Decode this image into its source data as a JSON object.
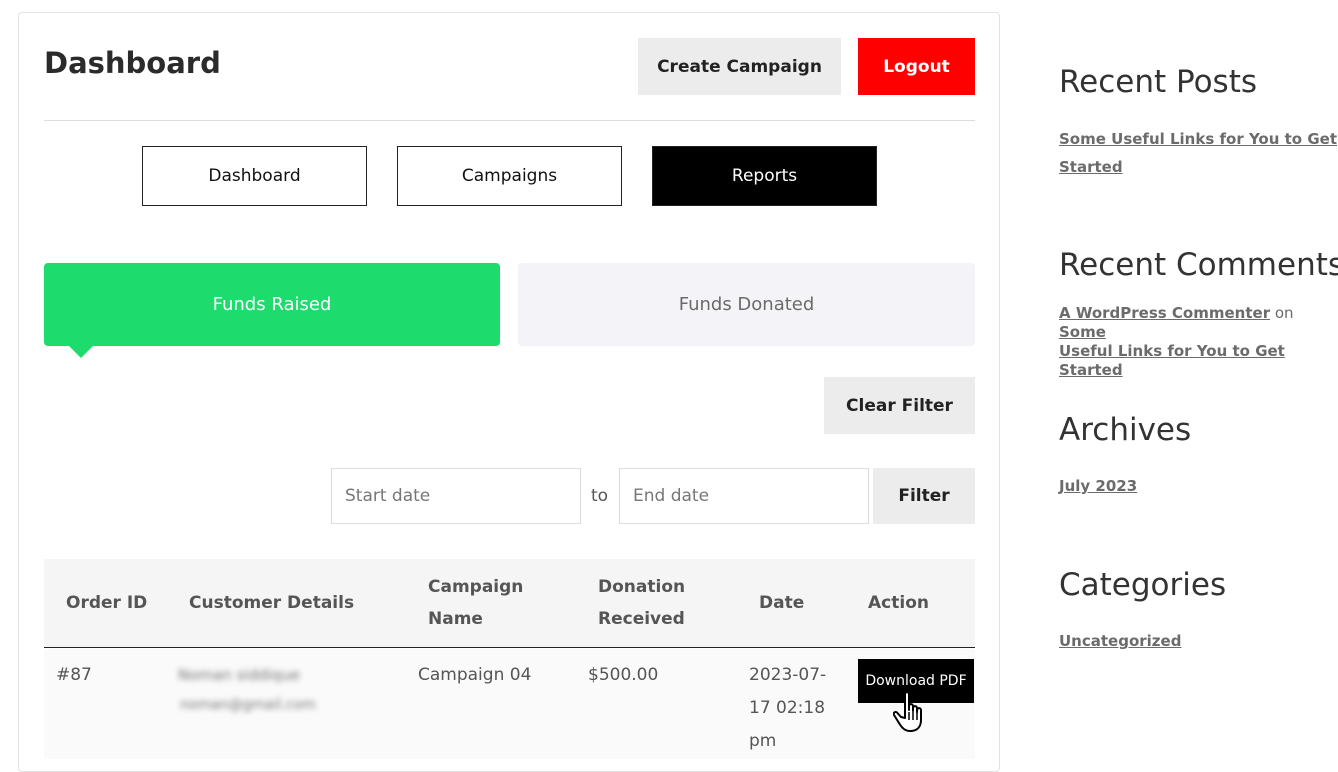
{
  "header": {
    "title": "Dashboard",
    "create_label": "Create Campaign",
    "logout_label": "Logout"
  },
  "nav": {
    "items": [
      {
        "label": "Dashboard",
        "active": false
      },
      {
        "label": "Campaigns",
        "active": false
      },
      {
        "label": "Reports",
        "active": true
      }
    ]
  },
  "tabs": [
    {
      "label": "Funds Raised",
      "active": true
    },
    {
      "label": "Funds Donated",
      "active": false
    }
  ],
  "filters": {
    "clear_label": "Clear Filter",
    "start_placeholder": "Start date",
    "to_label": "to",
    "end_placeholder": "End date",
    "filter_label": "Filter"
  },
  "table": {
    "columns": [
      [
        "Order ID"
      ],
      [
        "Customer Details"
      ],
      [
        "Campaign",
        "Name"
      ],
      [
        "Donation",
        "Received"
      ],
      [
        "Date"
      ],
      [
        "Action"
      ]
    ],
    "rows": [
      {
        "order_id": "#87",
        "customer_name": "Noman siddique",
        "customer_email": "noman@gmail.com",
        "campaign": "Campaign 04",
        "donation": "$500.00",
        "date_lines": [
          "2023-07-",
          "17 02:18",
          "pm"
        ],
        "action_label": "Download PDF"
      }
    ]
  },
  "sidebar": {
    "recent_posts": {
      "heading": "Recent Posts",
      "link_lines": [
        "Some Useful Links for You to Get",
        "Started"
      ]
    },
    "recent_comments": {
      "heading": "Recent Comments",
      "author": "A WordPress Commenter",
      "on": "on",
      "post_first": "Some",
      "post_rest": "Useful Links for You to Get Started"
    },
    "archives": {
      "heading": "Archives",
      "link": "July 2023"
    },
    "categories": {
      "heading": "Categories",
      "link": "Uncategorized"
    }
  },
  "colors": {
    "accent_green": "#1ddb6c",
    "logout_red": "#ff0000",
    "active_nav": "#000000"
  }
}
